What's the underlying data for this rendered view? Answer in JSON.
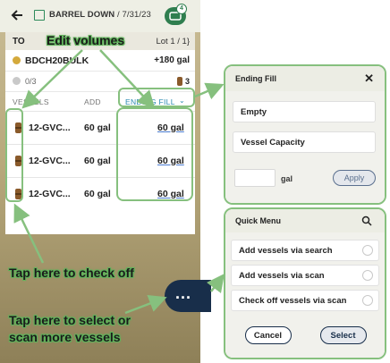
{
  "topbar": {
    "title": "BARREL DOWN",
    "date": " / 7/31/23",
    "badge_count": "4"
  },
  "summary": {
    "to_label": "TO",
    "lot_label": "Lot 1 / 1}",
    "bulk_name": "BDCH20BULK",
    "bulk_gal": "+180 gal",
    "checked_count": "0/3",
    "vessel_count": "3"
  },
  "table": {
    "headers": {
      "vessels": "VESSELS",
      "add": "ADD",
      "ending_fill": "ENDING FILL"
    },
    "rows": [
      {
        "name": "12-GVC...",
        "add": "60 gal",
        "fill": "60 gal"
      },
      {
        "name": "12-GVC...",
        "add": "60 gal",
        "fill": "60 gal"
      },
      {
        "name": "12-GVC...",
        "add": "60 gal",
        "fill": "60 gal"
      }
    ]
  },
  "annotations": {
    "edit_volumes": "Edit volumes",
    "check_off": "Tap here to check off",
    "select_line1": "Tap here to select or",
    "select_line2": "scan more vessels"
  },
  "fab": {
    "label": "..."
  },
  "ending_fill_popup": {
    "title": "Ending Fill",
    "close": "✕",
    "option_empty": "Empty",
    "option_capacity": "Vessel Capacity",
    "unit": "gal",
    "apply": "Apply",
    "input_value": ""
  },
  "quick_menu": {
    "title": "Quick Menu",
    "items": [
      "Add vessels via search",
      "Add vessels via scan",
      "Check off vessels via scan"
    ],
    "cancel": "Cancel",
    "select": "Select"
  },
  "colors": {
    "accent_green": "#2f7e4f",
    "highlight_green": "#86c07e",
    "navy": "#182e4a",
    "link_blue": "#2a8ab0",
    "barrel_brown": "#8a5a2b"
  }
}
